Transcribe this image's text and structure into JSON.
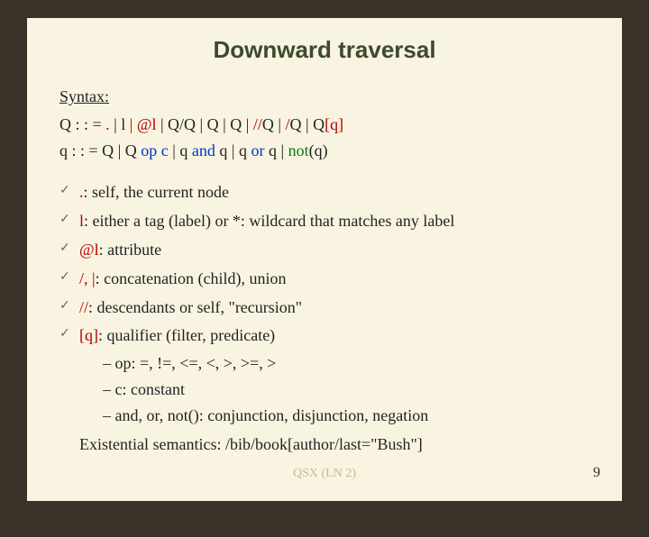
{
  "title": "Downward traversal",
  "syntax_label": "Syntax:",
  "grammar": {
    "line1": {
      "lhs": "Q : : =   ",
      "dot": ".",
      "p1": "   |   l   ",
      "atl": "|   @l",
      "p2": "    |   Q/Q    |    Q | Q    |  ",
      "slashslash": "//",
      "q1": "Q    |   ",
      "slash": "/",
      "q2": "Q    |    Q",
      "brq": "[q]"
    },
    "line2": {
      "lhs": "q  : : =  Q   |    Q ",
      "op": "op",
      "sp1": "  ",
      "c": "c",
      "sp2": "    |  q  ",
      "and": "and",
      "sp3": "  q    |    q  ",
      "or": "or",
      "sp4": "   q     |   ",
      "not": "not",
      "tail": "(q)"
    }
  },
  "bullets": [
    {
      "prefix": ".",
      "text": ": self, the current node"
    },
    {
      "prefix": "l",
      "text": ":  either a tag (label) or *: wildcard that matches any label"
    },
    {
      "prefix": "@l",
      "text": ": attribute"
    },
    {
      "prefix": "/, |",
      "text": ": concatenation (child), union"
    },
    {
      "prefix": "//",
      "text": ": descendants or self, \"recursion\""
    },
    {
      "prefix": "[q]",
      "text": ": qualifier (filter, predicate)"
    }
  ],
  "sublist": [
    "op: =, !=, <=, <, >, >=, >",
    "c:  constant",
    "and, or, not(): conjunction, disjunction, negation"
  ],
  "existential": "Existential semantics: /bib/book[author/last=\"Bush\"]",
  "footer_faded": "QSX (LN 2)",
  "page": "9"
}
